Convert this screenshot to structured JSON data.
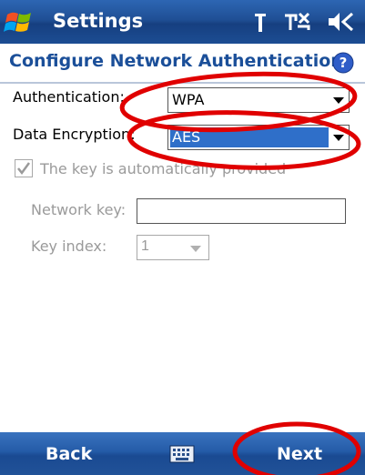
{
  "titlebar": {
    "app_title": "Settings",
    "icons": [
      "windows-start-icon",
      "antenna-icon",
      "connectivity-icon",
      "speaker-icon"
    ]
  },
  "header": {
    "title": "Configure Network Authentication",
    "help_icon": "help-icon"
  },
  "form": {
    "authentication": {
      "label": "Authentication:",
      "value": "WPA"
    },
    "data_encryption": {
      "label": "Data Encryption:",
      "value": "AES"
    },
    "auto_key": {
      "label": "The key is automatically provided",
      "checked": true
    },
    "network_key": {
      "label": "Network key:",
      "value": ""
    },
    "key_index": {
      "label": "Key index:",
      "value": "1"
    }
  },
  "softkeys": {
    "left": "Back",
    "right": "Next",
    "center_icon": "keyboard-icon"
  },
  "colors": {
    "accent": "#1b4f99",
    "annotation": "#e00000"
  }
}
